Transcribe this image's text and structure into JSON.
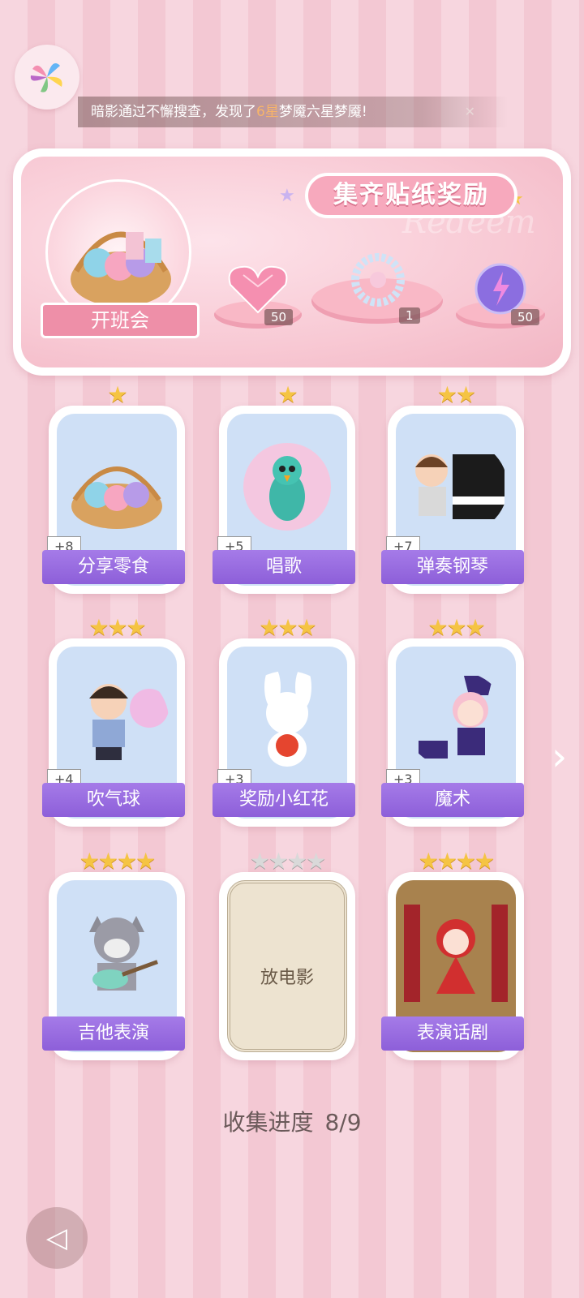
{
  "ticker": {
    "prefix": "暗影通过不懈搜查，发现了",
    "highlight": "6星",
    "suffix": "梦魇六星梦魇!",
    "close_icon": "close-icon"
  },
  "reward": {
    "title": "集齐贴纸奖励",
    "watermark": "Redeem",
    "event_label": "开班会",
    "items": [
      {
        "icon": "pink-heart-gem-icon",
        "count": "50"
      },
      {
        "icon": "crystal-bracelet-icon",
        "count": "1"
      },
      {
        "icon": "purple-lightning-orb-icon",
        "count": "50"
      }
    ]
  },
  "cards": [
    {
      "name": "分享零食",
      "stars": 1,
      "bonus": "+8",
      "locked": false,
      "art": "snack-basket"
    },
    {
      "name": "唱歌",
      "stars": 1,
      "bonus": "+5",
      "locked": false,
      "art": "singing-peacock"
    },
    {
      "name": "弹奏钢琴",
      "stars": 2,
      "bonus": "+7",
      "locked": false,
      "art": "boy-piano"
    },
    {
      "name": "吹气球",
      "stars": 3,
      "bonus": "+4",
      "locked": false,
      "art": "boy-bubblegum"
    },
    {
      "name": "奖励小红花",
      "stars": 3,
      "bonus": "+3",
      "locked": false,
      "art": "bunny-flower"
    },
    {
      "name": "魔术",
      "stars": 3,
      "bonus": "+3",
      "locked": false,
      "art": "magician-girl"
    },
    {
      "name": "吉他表演",
      "stars": 4,
      "bonus": "",
      "locked": false,
      "art": "wolf-guitar"
    },
    {
      "name": "放电影",
      "stars": 4,
      "bonus": "",
      "locked": true,
      "art": ""
    },
    {
      "name": "表演话剧",
      "stars": 4,
      "bonus": "",
      "locked": false,
      "art": "catgirl-theater"
    }
  ],
  "progress": {
    "label": "收集进度",
    "value": "8/9"
  },
  "colors": {
    "accent": "#9c6fe4",
    "star": "#f5c443",
    "panel_pink": "#f8c9d4"
  }
}
